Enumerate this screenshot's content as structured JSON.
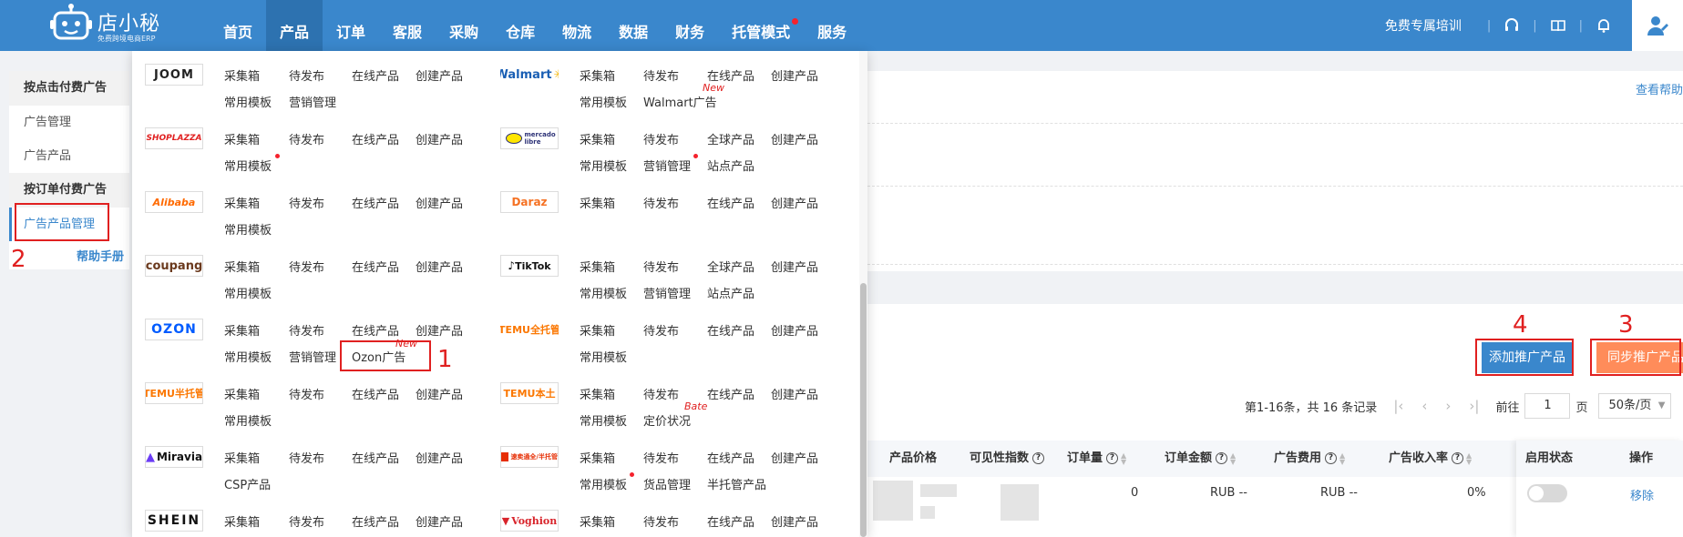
{
  "brand": {
    "name": "店小秘",
    "subtitle": "免费跨境电商ERP"
  },
  "nav": {
    "items": [
      {
        "label": "首页",
        "active": false,
        "dot": false
      },
      {
        "label": "产品",
        "active": true,
        "dot": false
      },
      {
        "label": "订单",
        "active": false,
        "dot": false
      },
      {
        "label": "客服",
        "active": false,
        "dot": false
      },
      {
        "label": "采购",
        "active": false,
        "dot": false
      },
      {
        "label": "仓库",
        "active": false,
        "dot": false
      },
      {
        "label": "物流",
        "active": false,
        "dot": false
      },
      {
        "label": "数据",
        "active": false,
        "dot": false
      },
      {
        "label": "财务",
        "active": false,
        "dot": false
      },
      {
        "label": "托管模式",
        "active": false,
        "dot": true
      },
      {
        "label": "服务",
        "active": false,
        "dot": false
      }
    ],
    "training": "免费专属培训",
    "icons": [
      "headset-icon",
      "book-icon",
      "bell-icon",
      "user-icon"
    ]
  },
  "sidebar": {
    "group1": "按点击付费广告",
    "item1": "广告管理",
    "item2": "广告产品",
    "group2": "按订单付费广告",
    "item3": "广告产品管理",
    "help": "帮助手册"
  },
  "annotations": {
    "n1": "1",
    "n2": "2",
    "n3": "3",
    "n4": "4"
  },
  "main": {
    "view_help": "查看帮助",
    "add_button": "添加推广产品",
    "sync_button": "同步推广产品",
    "pager": {
      "summary": "第1-16条，共 16 条记录",
      "goto": "前往",
      "page": "1",
      "page_unit": "页",
      "size": "50条/页"
    },
    "columns": {
      "price": "产品价格",
      "visibility": "可见性指数",
      "orders": "订单量",
      "amount": "订单金额",
      "cost": "广告费用",
      "rate": "广告收入率",
      "status": "启用状态",
      "action": "操作"
    },
    "row": {
      "orders": "0",
      "amount": "RUB --",
      "cost": "RUB --",
      "rate": "0%",
      "remove": "移除"
    }
  },
  "menu": {
    "joom": {
      "logo": "JOOM",
      "links": [
        "采集箱",
        "待发布",
        "在线产品",
        "创建产品",
        "常用模板",
        "营销管理"
      ]
    },
    "walmart": {
      "logo": "Walmart",
      "links": [
        "采集箱",
        "待发布",
        "在线产品",
        "创建产品",
        "常用模板",
        "Walmart广告"
      ],
      "new": "New"
    },
    "shoplazza": {
      "logo": "SHOPLAZZA",
      "links": [
        "采集箱",
        "待发布",
        "在线产品",
        "创建产品",
        "常用模板"
      ]
    },
    "mercado": {
      "logo": "mercado libre",
      "links": [
        "采集箱",
        "待发布",
        "全球产品",
        "创建产品",
        "常用模板",
        "营销管理",
        "站点产品"
      ]
    },
    "alibaba": {
      "logo": "Alibaba",
      "links": [
        "采集箱",
        "待发布",
        "在线产品",
        "创建产品",
        "常用模板"
      ]
    },
    "daraz": {
      "logo": "Daraz",
      "links": [
        "采集箱",
        "待发布",
        "在线产品",
        "创建产品"
      ]
    },
    "coupang": {
      "logo": "coupang",
      "links": [
        "采集箱",
        "待发布",
        "在线产品",
        "创建产品",
        "常用模板"
      ]
    },
    "tiktok": {
      "logo": "TikTok",
      "links": [
        "采集箱",
        "待发布",
        "全球产品",
        "创建产品",
        "常用模板",
        "营销管理",
        "站点产品"
      ]
    },
    "ozon": {
      "logo": "OZON",
      "links": [
        "采集箱",
        "待发布",
        "在线产品",
        "创建产品",
        "常用模板",
        "营销管理",
        "Ozon广告"
      ],
      "new": "New"
    },
    "temu_full": {
      "logo": "TEMU全托管",
      "links": [
        "采集箱",
        "待发布",
        "在线产品",
        "创建产品",
        "常用模板"
      ]
    },
    "temu_half": {
      "logo": "TEMU半托管",
      "links": [
        "采集箱",
        "待发布",
        "在线产品",
        "创建产品",
        "常用模板"
      ]
    },
    "temu_local": {
      "logo": "TEMU本土",
      "links": [
        "采集箱",
        "待发布",
        "在线产品",
        "创建产品",
        "常用模板",
        "定价状况"
      ],
      "bate": "Bate"
    },
    "miravia": {
      "logo": "Miravia",
      "links": [
        "采集箱",
        "待发布",
        "在线产品",
        "创建产品",
        "CSP产品"
      ]
    },
    "speedsell": {
      "logo": "速卖通全/半托管",
      "links": [
        "采集箱",
        "待发布",
        "在线产品",
        "创建产品",
        "常用模板",
        "货品管理",
        "半托管产品"
      ]
    },
    "shein": {
      "logo": "SHEIN",
      "links": [
        "采集箱",
        "待发布",
        "在线产品",
        "创建产品"
      ]
    },
    "voghion": {
      "logo": "Voghion",
      "links": [
        "采集箱",
        "待发布",
        "在线产品",
        "创建产品"
      ]
    }
  }
}
